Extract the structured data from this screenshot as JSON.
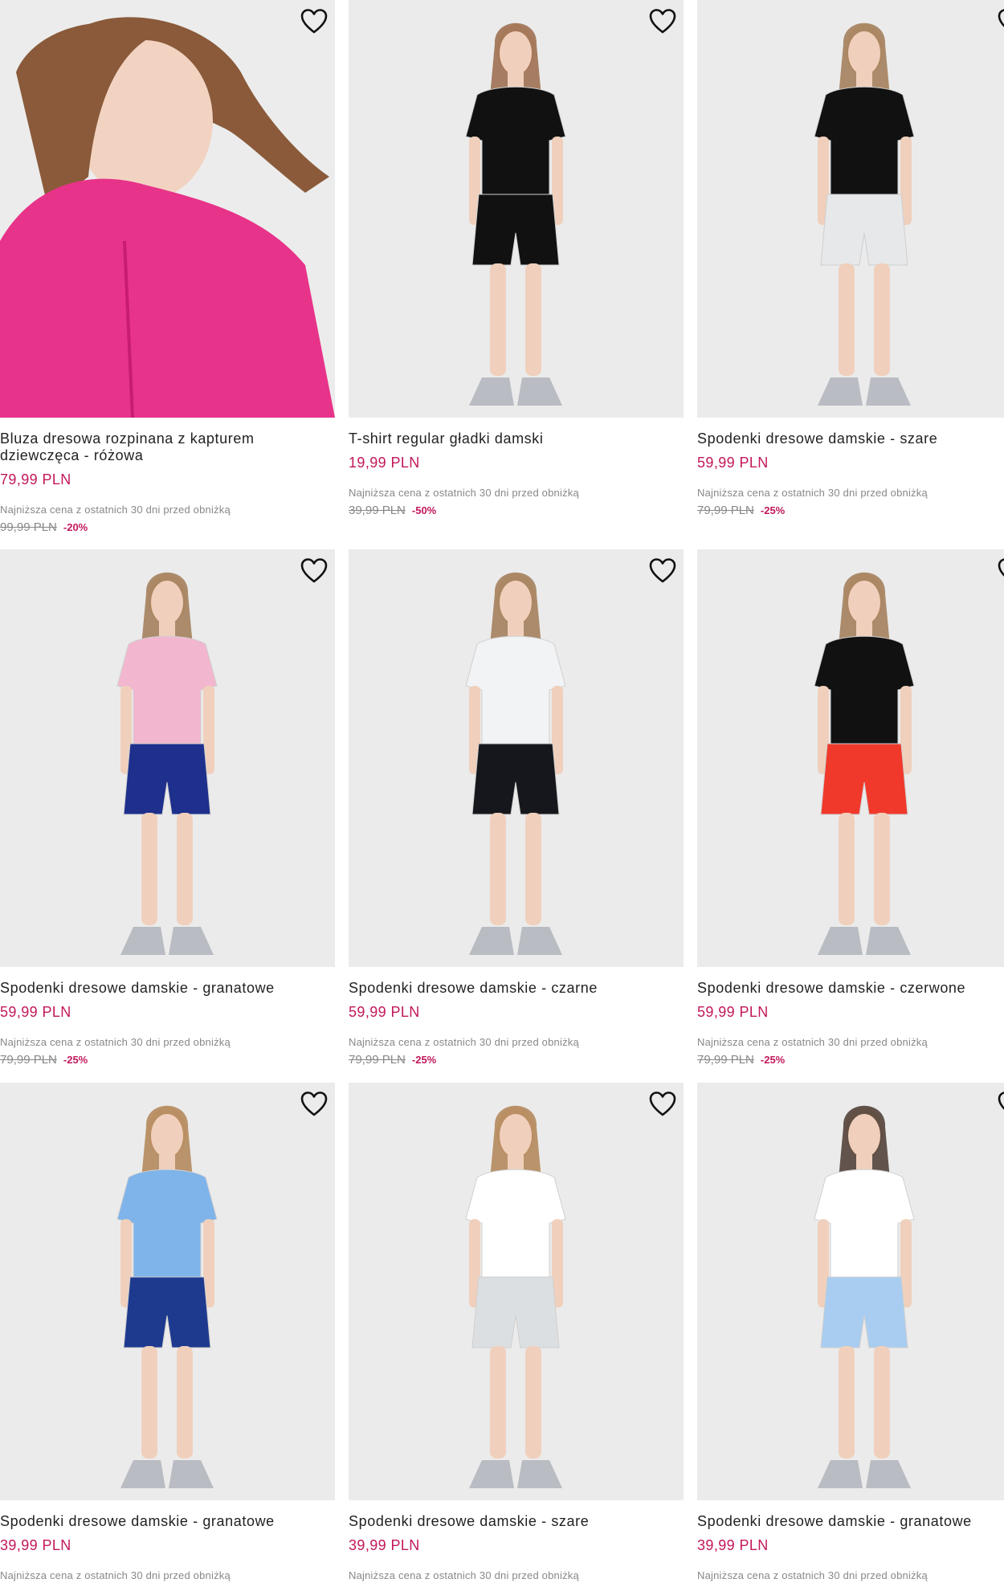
{
  "products": [
    {
      "title": "Bluza dresowa rozpinana z kapturem dziewczęca - różowa",
      "price": "79,99 PLN",
      "lowest_label": "Najniższa cena z ostatnich 30 dni przed obniżką",
      "old_price": "99,99 PLN",
      "discount": "-20%",
      "top_color": "#e8338a",
      "bottom_color": "#e8338a",
      "skin": "#f2d3c2",
      "hair": "#8a5a3a"
    },
    {
      "title": "T-shirt regular gładki damski",
      "price": "19,99 PLN",
      "lowest_label": "Najniższa cena z ostatnich 30 dni przed obniżką",
      "old_price": "39,99 PLN",
      "discount": "-50%",
      "top_color": "#111111",
      "bottom_color": "#111111",
      "skin": "#f0d0bc",
      "hair": "#9a6a4a"
    },
    {
      "title": "Spodenki dresowe damskie - szare",
      "price": "59,99 PLN",
      "lowest_label": "Najniższa cena z ostatnich 30 dni przed obniżką",
      "old_price": "79,99 PLN",
      "discount": "-25%",
      "top_color": "#111111",
      "bottom_color": "#e6e8ea",
      "skin": "#f0d0bc",
      "hair": "#a07a55"
    },
    {
      "title": "Spodenki dresowe damskie - granatowe",
      "price": "59,99 PLN",
      "lowest_label": "Najniższa cena z ostatnich 30 dni przed obniżką",
      "old_price": "79,99 PLN",
      "discount": "-25%",
      "top_color": "#f3b6cf",
      "bottom_color": "#1e2f8c",
      "skin": "#f0d0bc",
      "hair": "#a07a55"
    },
    {
      "title": "Spodenki dresowe damskie - czarne",
      "price": "59,99 PLN",
      "lowest_label": "Najniższa cena z ostatnich 30 dni przed obniżką",
      "old_price": "79,99 PLN",
      "discount": "-25%",
      "top_color": "#f2f3f5",
      "bottom_color": "#15171c",
      "skin": "#f0d0bc",
      "hair": "#a07a55"
    },
    {
      "title": "Spodenki dresowe damskie - czerwone",
      "price": "59,99 PLN",
      "lowest_label": "Najniższa cena z ostatnich 30 dni przed obniżką",
      "old_price": "79,99 PLN",
      "discount": "-25%",
      "top_color": "#111111",
      "bottom_color": "#f0392b",
      "skin": "#f0d0bc",
      "hair": "#a07a55"
    },
    {
      "title": "Spodenki dresowe damskie - granatowe",
      "price": "39,99 PLN",
      "lowest_label": "Najniższa cena z ostatnich 30 dni przed obniżką",
      "old_price": "",
      "discount": "",
      "top_color": "#7fb4ea",
      "bottom_color": "#1e3a8f",
      "skin": "#f0d0bc",
      "hair": "#b08455"
    },
    {
      "title": "Spodenki dresowe damskie - szare",
      "price": "39,99 PLN",
      "lowest_label": "Najniższa cena z ostatnich 30 dni przed obniżką",
      "old_price": "",
      "discount": "",
      "top_color": "#ffffff",
      "bottom_color": "#dcdfe2",
      "skin": "#f0d0bc",
      "hair": "#b08455"
    },
    {
      "title": "Spodenki dresowe damskie - granatowe",
      "price": "39,99 PLN",
      "lowest_label": "Najniższa cena z ostatnich 30 dni przed obniżką",
      "old_price": "",
      "discount": "",
      "top_color": "#ffffff",
      "bottom_color": "#a9cdf0",
      "skin": "#f0d0bc",
      "hair": "#4a3a30"
    }
  ],
  "colors": {
    "price": "#c2185b",
    "image_bg": "#e8e8e8"
  },
  "icons": {
    "favorite": "heart-outline-icon"
  }
}
